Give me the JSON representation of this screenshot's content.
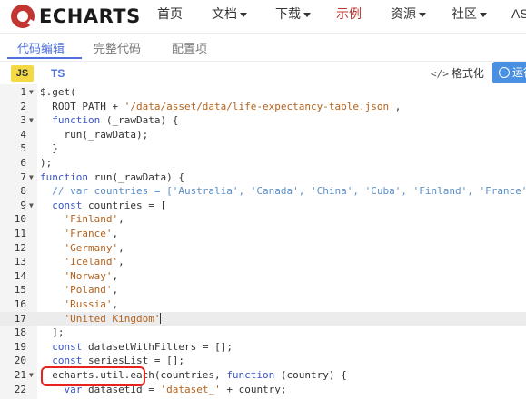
{
  "nav": {
    "logo_text": "ECHARTS",
    "items": [
      {
        "label": "首页",
        "dropdown": false
      },
      {
        "label": "文档",
        "dropdown": true
      },
      {
        "label": "下载",
        "dropdown": true
      },
      {
        "label": "示例",
        "dropdown": false,
        "active": true
      },
      {
        "label": "资源",
        "dropdown": true
      },
      {
        "label": "社区",
        "dropdown": true
      },
      {
        "label": "AS",
        "dropdown": false
      }
    ]
  },
  "tabs": [
    "代码编辑",
    "完整代码",
    "配置项"
  ],
  "toolbar": {
    "js_label": "JS",
    "ts_label": "TS",
    "format_icon": "</>",
    "format_label": "格式化",
    "run_label": "运行"
  },
  "colors": {
    "brand": "#c23531",
    "accent": "#5070dd",
    "keyword": "#3a55c4",
    "string": "#b5621c",
    "comment": "#5b8fc7",
    "annotation": "#e8221d"
  },
  "editor": {
    "highlighted_line": 17,
    "lines": [
      {
        "n": "1",
        "fold": true,
        "tokens": [
          {
            "t": "p",
            "v": "$.get("
          }
        ]
      },
      {
        "n": "2",
        "fold": false,
        "tokens": [
          {
            "t": "p",
            "v": "  ROOT_PATH + "
          },
          {
            "t": "s",
            "v": "'/data/asset/data/life-expectancy-table.json'"
          },
          {
            "t": "p",
            "v": ","
          }
        ]
      },
      {
        "n": "3",
        "fold": true,
        "tokens": [
          {
            "t": "p",
            "v": "  "
          },
          {
            "t": "k",
            "v": "function"
          },
          {
            "t": "p",
            "v": " (_rawData) {"
          }
        ]
      },
      {
        "n": "4",
        "fold": false,
        "tokens": [
          {
            "t": "p",
            "v": "    run(_rawData);"
          }
        ]
      },
      {
        "n": "5",
        "fold": false,
        "tokens": [
          {
            "t": "p",
            "v": "  }"
          }
        ]
      },
      {
        "n": "6",
        "fold": false,
        "tokens": [
          {
            "t": "p",
            "v": ");"
          }
        ]
      },
      {
        "n": "7",
        "fold": true,
        "tokens": [
          {
            "t": "k",
            "v": "function"
          },
          {
            "t": "p",
            "v": " run(_rawData) {"
          }
        ]
      },
      {
        "n": "8",
        "fold": false,
        "tokens": [
          {
            "t": "c",
            "v": "  // var countries = ['Australia', 'Canada', 'China', 'Cuba', 'Finland', 'France', 'Germany',"
          }
        ]
      },
      {
        "n": "9",
        "fold": true,
        "tokens": [
          {
            "t": "p",
            "v": "  "
          },
          {
            "t": "k",
            "v": "const"
          },
          {
            "t": "p",
            "v": " countries = ["
          }
        ]
      },
      {
        "n": "10",
        "fold": false,
        "tokens": [
          {
            "t": "p",
            "v": "    "
          },
          {
            "t": "s",
            "v": "'Finland'"
          },
          {
            "t": "p",
            "v": ","
          }
        ]
      },
      {
        "n": "11",
        "fold": false,
        "tokens": [
          {
            "t": "p",
            "v": "    "
          },
          {
            "t": "s",
            "v": "'France'"
          },
          {
            "t": "p",
            "v": ","
          }
        ]
      },
      {
        "n": "12",
        "fold": false,
        "tokens": [
          {
            "t": "p",
            "v": "    "
          },
          {
            "t": "s",
            "v": "'Germany'"
          },
          {
            "t": "p",
            "v": ","
          }
        ]
      },
      {
        "n": "13",
        "fold": false,
        "tokens": [
          {
            "t": "p",
            "v": "    "
          },
          {
            "t": "s",
            "v": "'Iceland'"
          },
          {
            "t": "p",
            "v": ","
          }
        ]
      },
      {
        "n": "14",
        "fold": false,
        "tokens": [
          {
            "t": "p",
            "v": "    "
          },
          {
            "t": "s",
            "v": "'Norway'"
          },
          {
            "t": "p",
            "v": ","
          }
        ]
      },
      {
        "n": "15",
        "fold": false,
        "tokens": [
          {
            "t": "p",
            "v": "    "
          },
          {
            "t": "s",
            "v": "'Poland'"
          },
          {
            "t": "p",
            "v": ","
          }
        ]
      },
      {
        "n": "16",
        "fold": false,
        "tokens": [
          {
            "t": "p",
            "v": "    "
          },
          {
            "t": "s",
            "v": "'Russia'"
          },
          {
            "t": "p",
            "v": ","
          }
        ]
      },
      {
        "n": "17",
        "fold": false,
        "tokens": [
          {
            "t": "p",
            "v": "    "
          },
          {
            "t": "s",
            "v": "'United Kingdom'"
          }
        ],
        "cursor": true
      },
      {
        "n": "18",
        "fold": false,
        "tokens": [
          {
            "t": "p",
            "v": "  ];"
          }
        ]
      },
      {
        "n": "19",
        "fold": false,
        "tokens": [
          {
            "t": "p",
            "v": "  "
          },
          {
            "t": "k",
            "v": "const"
          },
          {
            "t": "p",
            "v": " datasetWithFilters = [];"
          }
        ]
      },
      {
        "n": "20",
        "fold": false,
        "tokens": [
          {
            "t": "p",
            "v": "  "
          },
          {
            "t": "k",
            "v": "const"
          },
          {
            "t": "p",
            "v": " seriesList = [];"
          }
        ]
      },
      {
        "n": "21",
        "fold": true,
        "tokens": [
          {
            "t": "p",
            "v": "  echarts.util.each(countries, "
          },
          {
            "t": "k",
            "v": "function"
          },
          {
            "t": "p",
            "v": " (country) {"
          }
        ]
      },
      {
        "n": "22",
        "fold": false,
        "tokens": [
          {
            "t": "p",
            "v": "    "
          },
          {
            "t": "k",
            "v": "var"
          },
          {
            "t": "p",
            "v": " datasetId = "
          },
          {
            "t": "s",
            "v": "'dataset_'"
          },
          {
            "t": "p",
            "v": " + country;"
          }
        ]
      }
    ]
  }
}
